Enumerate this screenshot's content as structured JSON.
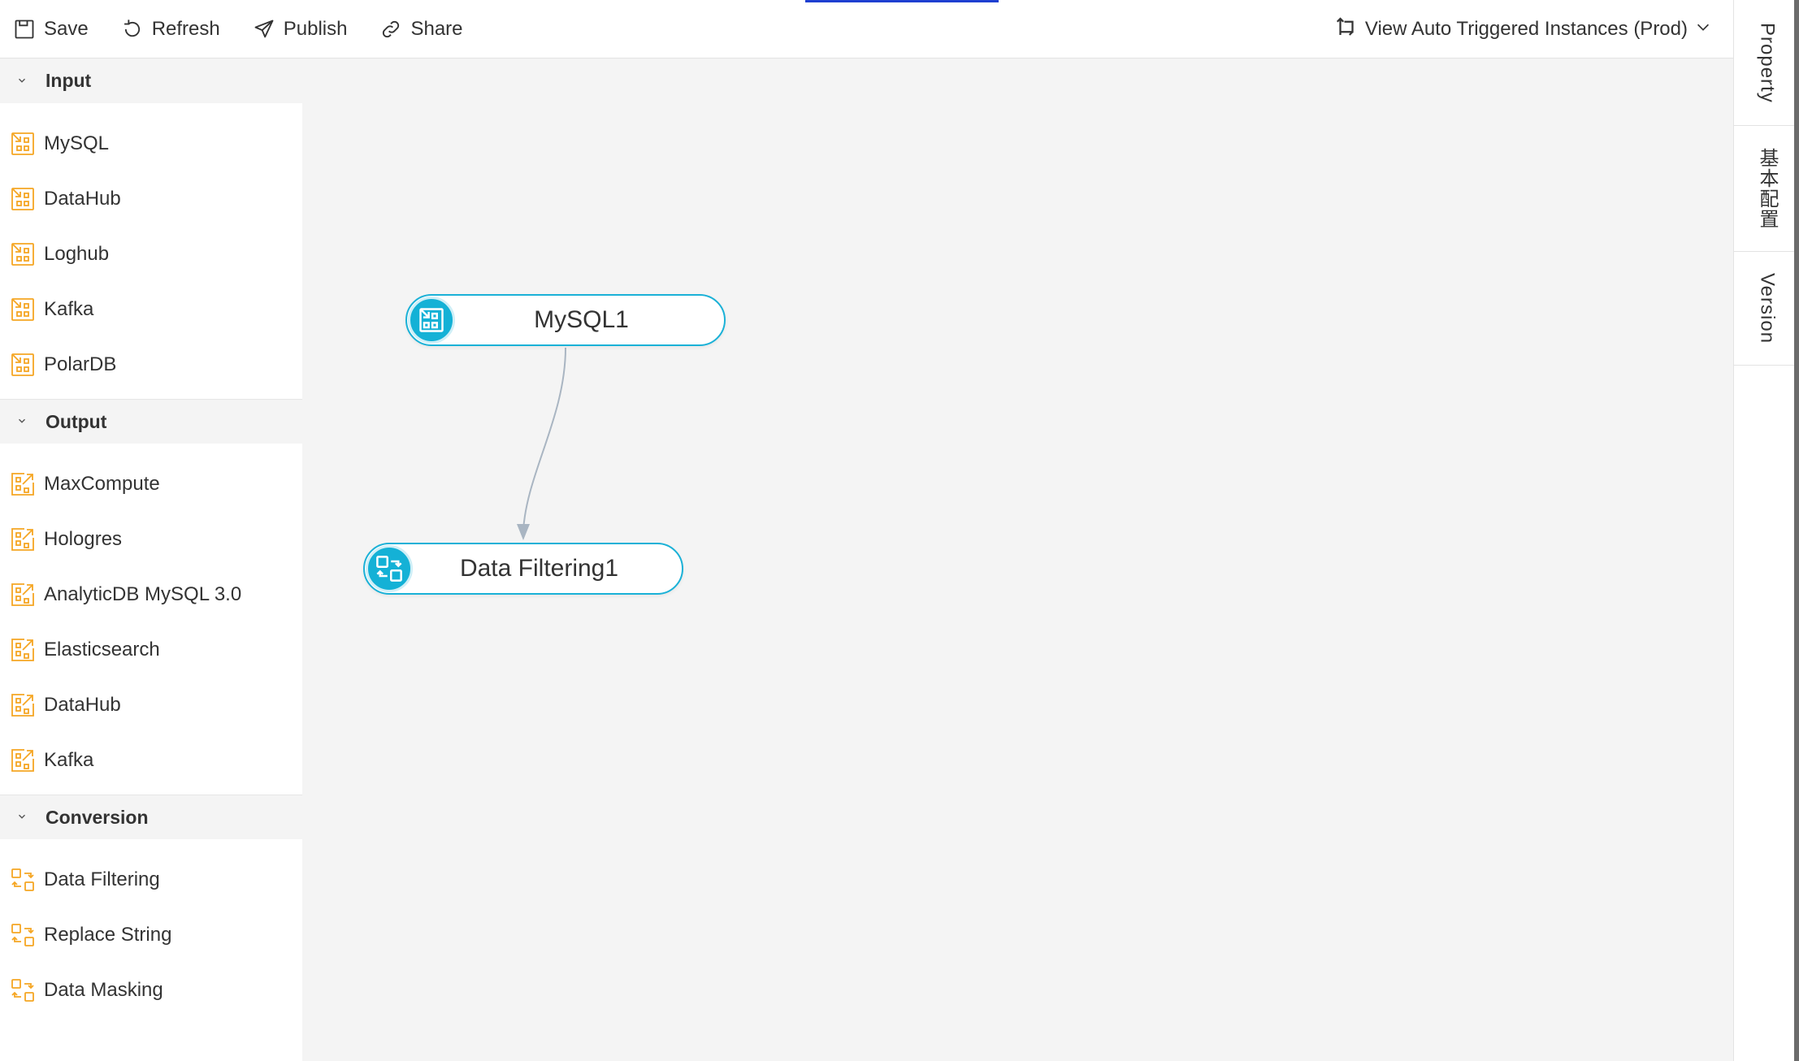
{
  "toolbar": {
    "save": "Save",
    "refresh": "Refresh",
    "publish": "Publish",
    "share": "Share",
    "view_instances": "View Auto Triggered Instances (Prod)"
  },
  "palette": {
    "groups": [
      {
        "label": "Input",
        "items": [
          "MySQL",
          "DataHub",
          "Loghub",
          "Kafka",
          "PolarDB"
        ]
      },
      {
        "label": "Output",
        "items": [
          "MaxCompute",
          "Hologres",
          "AnalyticDB MySQL 3.0",
          "Elasticsearch",
          "DataHub",
          "Kafka"
        ]
      },
      {
        "label": "Conversion",
        "items": [
          "Data Filtering",
          "Replace String",
          "Data Masking"
        ]
      }
    ]
  },
  "canvas": {
    "nodes": [
      {
        "label": "MySQL1",
        "icon": "input-node-icon"
      },
      {
        "label": "Data Filtering1",
        "icon": "conversion-node-icon"
      }
    ]
  },
  "rail": {
    "tabs": [
      "Property",
      "基本配置",
      "Version"
    ]
  },
  "colors": {
    "accent": "#14b1d6",
    "palette_icon": "#f5a623",
    "top_indicator": "#1e3fd1"
  }
}
